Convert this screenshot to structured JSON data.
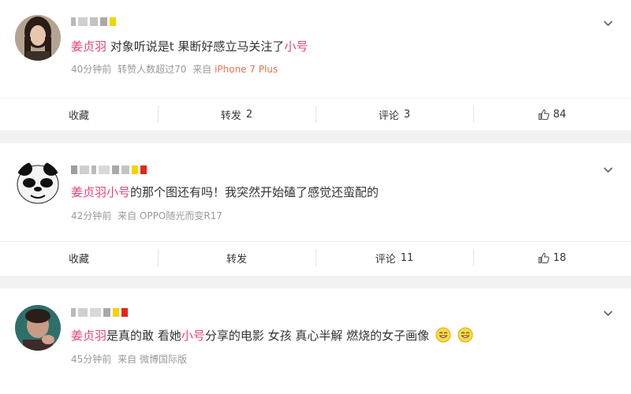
{
  "posts": [
    {
      "content": {
        "mention": "姜贞羽",
        "text": " 对象听说是t 果断好感立马关注了",
        "tail": "小号"
      },
      "meta": {
        "time": "40分钟前",
        "info": "转赞人数超过70",
        "from": "来自",
        "device": "iPhone 7 Plus"
      },
      "actions": {
        "favorite": "收藏",
        "repost": "转发",
        "repost_count": "2",
        "comment": "评论",
        "comment_count": "3",
        "like_count": "84"
      }
    },
    {
      "content": {
        "mention": "姜贞羽",
        "tail": "小号",
        "text": "的那个图还有吗！我突然开始磕了感觉还蛮配的"
      },
      "meta": {
        "time": "42分钟前",
        "from": "来自",
        "device": "OPPO随光而变R17"
      },
      "actions": {
        "favorite": "收藏",
        "repost": "转发",
        "comment": "评论",
        "comment_count": "11",
        "like_count": "18"
      }
    },
    {
      "content": {
        "mention": "姜贞羽",
        "text1": "是真的敢 看她",
        "tail": "小号",
        "text2": "分享的电影 女孩 真心半解 燃烧的女子画像"
      },
      "meta": {
        "time": "45分钟前",
        "from": "来自",
        "device": "微博国际版"
      }
    }
  ],
  "colors": {
    "mention": "#eb7350",
    "highlight": "#e8407a",
    "meta": "#999999",
    "background": "#f2f2f2"
  },
  "icons": [
    "chevron-down-icon",
    "thumbs-up-icon",
    "smile-emoji-icon"
  ]
}
